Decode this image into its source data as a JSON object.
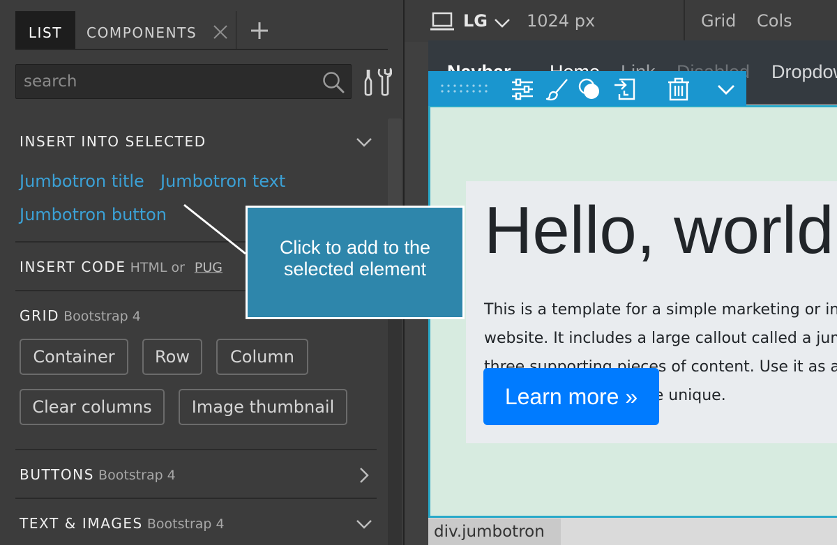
{
  "tabs": {
    "list": "LIST",
    "components": "COMPONENTS"
  },
  "search": {
    "placeholder": "search"
  },
  "sections": {
    "insert_selected": {
      "title": "INSERT INTO SELECTED",
      "links": [
        "Jumbotron title",
        "Jumbotron text",
        "Jumbotron button"
      ]
    },
    "insert_code": {
      "title": "INSERT CODE",
      "sub": "HTML or",
      "link": "PUG"
    },
    "grid": {
      "title": "GRID",
      "sub": "Bootstrap 4",
      "buttons": [
        "Container",
        "Row",
        "Column",
        "Clear columns",
        "Image thumbnail"
      ]
    },
    "buttons": {
      "title": "BUTTONS",
      "sub": "Bootstrap 4"
    },
    "text_images": {
      "title": "TEXT & IMAGES",
      "sub": "Bootstrap 4"
    }
  },
  "toolbar": {
    "device": "LG",
    "width": "1024 px",
    "grid": "Grid",
    "cols": "Cols"
  },
  "navbar": {
    "items": [
      "Navbar",
      "Home",
      "Link",
      "Disabled",
      "Dropdown"
    ]
  },
  "jumbotron": {
    "title": "Hello, world!",
    "text": "This is a template for a simple marketing or informational website. It includes a large callout called a jumbotron and three supporting pieces of content. Use it as a starting point to create something more unique.",
    "button": "Learn more »"
  },
  "element_label": "div.jumbotron",
  "callout": "Click to add to the selected element",
  "icons": {
    "close": "close-icon",
    "add": "plus-icon",
    "search": "search-icon",
    "tools": "tools-icon",
    "device": "laptop-icon",
    "toolbar": [
      "drag-handle-icon",
      "settings-sliders-icon",
      "brush-icon",
      "circles-icon",
      "insert-icon",
      "trash-icon",
      "chevron-down-icon"
    ]
  },
  "colors": {
    "link": "#3ba1d6",
    "primary": "#007bff",
    "callout": "#2e86ab",
    "toolbar": "#1a96cf"
  }
}
